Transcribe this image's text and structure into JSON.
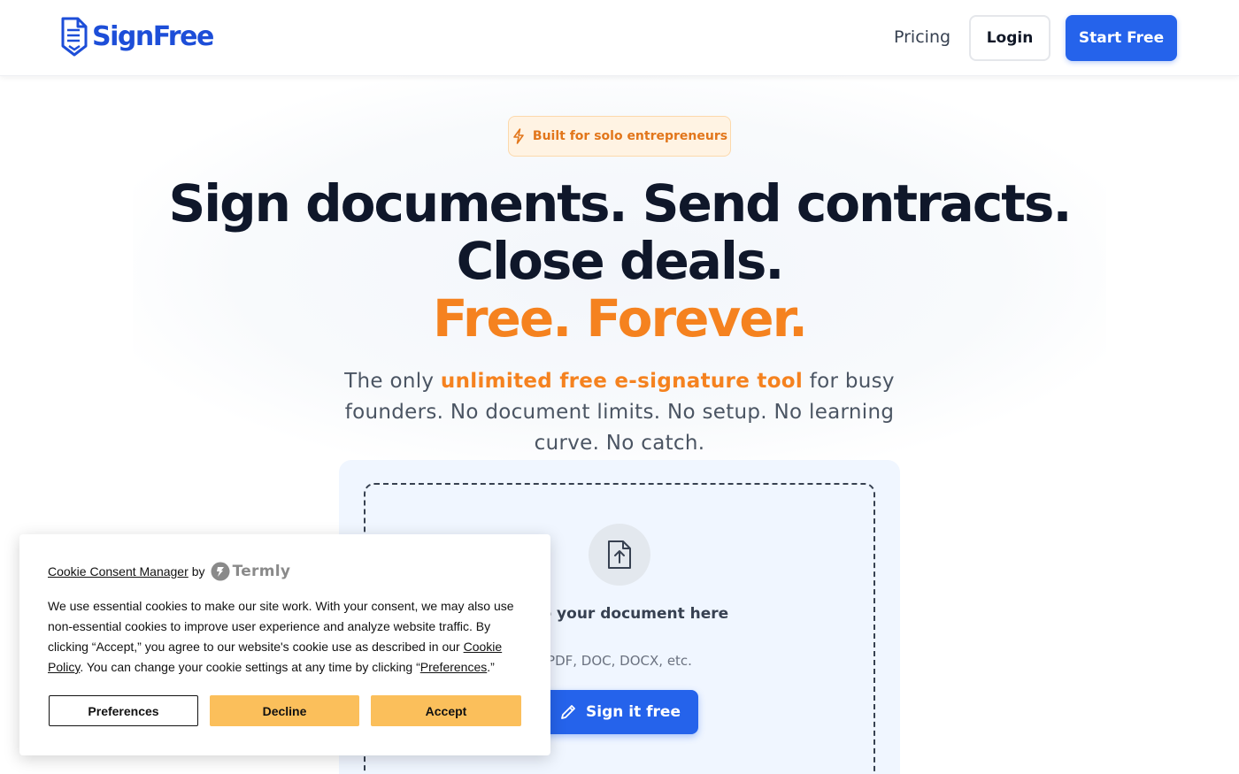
{
  "header": {
    "logo_text": "SignFree",
    "nav_pricing": "Pricing",
    "login_label": "Login",
    "start_label": "Start Free"
  },
  "hero": {
    "badge": "Built for solo entrepreneurs",
    "headline_line1": "Sign documents. Send contracts.",
    "headline_line2": "Close deals.",
    "headline_line3": "Free. Forever.",
    "subtitle_prefix": "The only ",
    "subtitle_highlight": "unlimited free e-signature tool",
    "subtitle_suffix": " for busy founders. No document limits. No setup. No learning curve. No catch."
  },
  "upload": {
    "drop_text": "Drop your document here",
    "formats": "PDF, DOC, DOCX, etc.",
    "button_label": "Sign it free"
  },
  "cookie": {
    "manager_link": "Cookie Consent Manager",
    "by": "by",
    "brand": "Termly",
    "body_1": "We use essential cookies to make our site work. With your consent, we may also use non-essential cookies to improve user experience and analyze website traffic. By clicking “Accept,” you agree to our website's cookie use as described in our ",
    "policy_link": "Cookie Policy",
    "body_2": ". You can change your cookie settings at any time by clicking “",
    "preferences_link": "Preferences",
    "body_3": ".”",
    "btn_preferences": "Preferences",
    "btn_decline": "Decline",
    "btn_accept": "Accept"
  },
  "colors": {
    "primary": "#2563eb",
    "accent_orange": "#f5821f",
    "cookie_button": "#fbbf5b"
  },
  "icons": [
    "logo-mark-icon",
    "lightning-icon",
    "upload-file-icon",
    "pen-icon",
    "termly-logo-icon"
  ]
}
